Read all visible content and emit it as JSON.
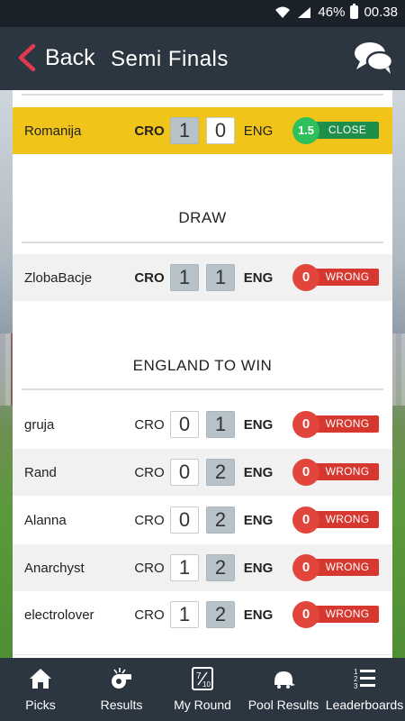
{
  "status": {
    "battery": "46%",
    "time": "00.38"
  },
  "header": {
    "back_label": "Back",
    "title": "Semi Finals"
  },
  "colors": {
    "accent": "#e23a4e",
    "highlight": "#f0c419",
    "wrong": "#d6382f",
    "close": "#1e8f4a"
  },
  "sections": [
    {
      "title": "DRAW"
    },
    {
      "title": "ENGLAND TO WIN"
    }
  ],
  "rows": [
    {
      "player": "Romanija",
      "team_a": "CRO",
      "score_a": "1",
      "score_b": "0",
      "team_b": "ENG",
      "points": "1.5",
      "result": "CLOSE"
    },
    {
      "player": "ZlobaBacje",
      "team_a": "CRO",
      "score_a": "1",
      "score_b": "1",
      "team_b": "ENG",
      "points": "0",
      "result": "WRONG"
    },
    {
      "player": "gruja",
      "team_a": "CRO",
      "score_a": "0",
      "score_b": "1",
      "team_b": "ENG",
      "points": "0",
      "result": "WRONG"
    },
    {
      "player": "Rand",
      "team_a": "CRO",
      "score_a": "0",
      "score_b": "2",
      "team_b": "ENG",
      "points": "0",
      "result": "WRONG"
    },
    {
      "player": "Alanna",
      "team_a": "CRO",
      "score_a": "0",
      "score_b": "2",
      "team_b": "ENG",
      "points": "0",
      "result": "WRONG"
    },
    {
      "player": "Anarchyst",
      "team_a": "CRO",
      "score_a": "1",
      "score_b": "2",
      "team_b": "ENG",
      "points": "0",
      "result": "WRONG"
    },
    {
      "player": "electrolover",
      "team_a": "CRO",
      "score_a": "1",
      "score_b": "2",
      "team_b": "ENG",
      "points": "0",
      "result": "WRONG"
    }
  ],
  "nav": [
    {
      "label": "Picks",
      "icon": "home-icon"
    },
    {
      "label": "Results",
      "icon": "whistle-icon"
    },
    {
      "label": "My Round",
      "icon": "round-score-icon"
    },
    {
      "label": "Pool Results",
      "icon": "cap-icon"
    },
    {
      "label": "Leaderboards",
      "icon": "ranked-list-icon"
    }
  ]
}
